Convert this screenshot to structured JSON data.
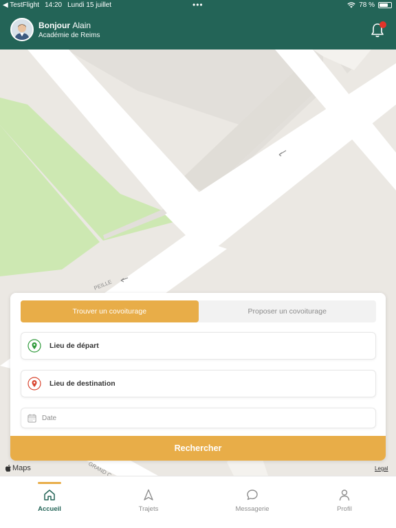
{
  "status_bar": {
    "back_app": "◀ TestFlight",
    "time": "14:20",
    "date": "Lundi 15 juillet",
    "dots": "•••",
    "battery_text": "78 %",
    "battery_level": 0.78
  },
  "header": {
    "greeting_prefix": "Bonjour",
    "user_name": "Alain",
    "academy": "Académie de Reims",
    "has_notification": true
  },
  "map": {
    "street_labels": [
      "PEILLE",
      "GRAND C"
    ],
    "maps_brand": "Maps",
    "legal": "Legal"
  },
  "search": {
    "tabs": [
      {
        "label": "Trouver un covoiturage",
        "active": true
      },
      {
        "label": "Proposer un covoiturage",
        "active": false
      }
    ],
    "departure_placeholder": "Lieu de départ",
    "destination_placeholder": "Lieu de destination",
    "date_placeholder": "Date",
    "submit_label": "Rechercher"
  },
  "nav": {
    "items": [
      {
        "label": "Accueil",
        "icon": "home-icon",
        "active": true
      },
      {
        "label": "Trajets",
        "icon": "navigation-arrow-icon",
        "active": false
      },
      {
        "label": "Messagerie",
        "icon": "chat-bubble-icon",
        "active": false
      },
      {
        "label": "Profil",
        "icon": "user-icon",
        "active": false
      }
    ]
  },
  "colors": {
    "header": "#236457",
    "accent": "#e8ad48",
    "notification": "#e2342a",
    "departure_pin": "#2e9a3a",
    "destination_pin": "#d9452f",
    "park": "#cde8b2"
  }
}
